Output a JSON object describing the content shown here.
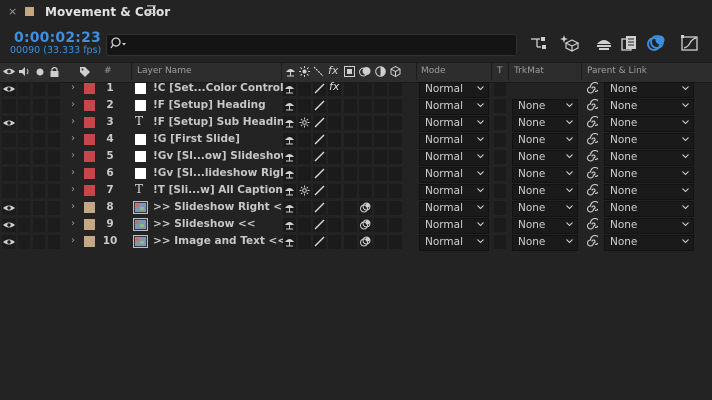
{
  "panel": {
    "title": "Movement & Color",
    "swatch_color": "#c4a883",
    "close_glyph": "×",
    "menu_glyph": "☰"
  },
  "time": {
    "timecode": "0:00:02:23",
    "frames": "00090 (33.333 fps)"
  },
  "search": {
    "placeholder": ""
  },
  "toolbar": [
    "comp-flowchart-icon",
    "draft-3d-icon",
    "shy-layers-icon",
    "frame-blending-icon",
    "motion-blur-icon",
    "graph-editor-icon"
  ],
  "headers": {
    "layer_name": "Layer Name",
    "num": "#",
    "mode": "Mode",
    "t": "T",
    "trkmat": "TrkMat",
    "parent": "Parent & Link"
  },
  "colors": {
    "accent": "#3d8fe0",
    "label_red": "#c8454a",
    "label_sand": "#c4a883"
  },
  "layers": [
    {
      "num": "1",
      "name": "!C [Set...Color Control",
      "type": "solid-white",
      "label": "red",
      "eye": true,
      "switches": "solid-fx",
      "mode": "Normal",
      "trkmat": "",
      "parent": "None"
    },
    {
      "num": "2",
      "name": "!F [Setup] Heading",
      "type": "solid-white",
      "label": "red",
      "eye": false,
      "switches": "solid",
      "mode": "Normal",
      "trkmat": "None",
      "parent": "None"
    },
    {
      "num": "3",
      "name": "!F [Setup] Sub Heading",
      "type": "text",
      "label": "red",
      "eye": true,
      "switches": "text",
      "mode": "Normal",
      "trkmat": "None",
      "parent": "None"
    },
    {
      "num": "4",
      "name": "!G [First Slide]",
      "type": "solid-white",
      "label": "red",
      "eye": false,
      "switches": "solid",
      "mode": "Normal",
      "trkmat": "None",
      "parent": "None"
    },
    {
      "num": "5",
      "name": "!Gv [Sl...ow] Slideshow",
      "type": "solid-white",
      "label": "red",
      "eye": false,
      "switches": "solid",
      "mode": "Normal",
      "trkmat": "None",
      "parent": "None"
    },
    {
      "num": "6",
      "name": "!Gv [Sl...lideshow Right",
      "type": "solid-white",
      "label": "red",
      "eye": false,
      "switches": "solid",
      "mode": "Normal",
      "trkmat": "None",
      "parent": "None"
    },
    {
      "num": "7",
      "name": "!T [Sli...w] All Captions",
      "type": "text",
      "label": "red",
      "eye": false,
      "switches": "text",
      "mode": "Normal",
      "trkmat": "None",
      "parent": "None"
    },
    {
      "num": "8",
      "name": ">> Slideshow Right <<",
      "type": "comp",
      "label": "sand",
      "eye": true,
      "switches": "comp",
      "mode": "Normal",
      "trkmat": "None",
      "parent": "None"
    },
    {
      "num": "9",
      "name": ">> Slideshow <<",
      "type": "comp",
      "label": "sand",
      "eye": true,
      "switches": "comp-mb",
      "mode": "Normal",
      "trkmat": "None",
      "parent": "None"
    },
    {
      "num": "10",
      "name": ">> Image and Text <<",
      "type": "comp",
      "label": "sand",
      "eye": true,
      "switches": "comp-mb",
      "mode": "Normal",
      "trkmat": "None",
      "parent": "None"
    }
  ]
}
